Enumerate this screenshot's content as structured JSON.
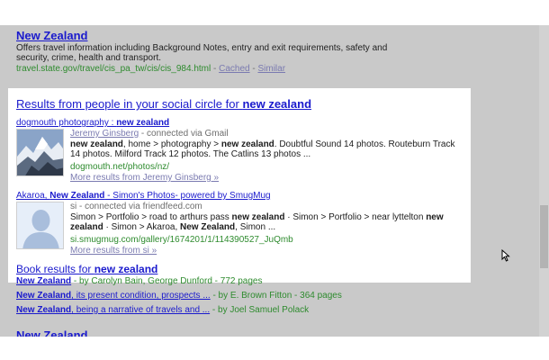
{
  "result_top": {
    "title": "New Zealand",
    "description": "Offers travel information including Background Notes, entry and exit requirements, safety and security, crime, health and transport.",
    "url": "travel.state.gov/travel/cis_pa_tw/cis/cis_984.html",
    "separator": " - ",
    "cached": "Cached",
    "similar": "Similar"
  },
  "social": {
    "heading_prefix": "Results from people in your social circle for ",
    "heading_query": "new zealand",
    "results": [
      {
        "title_prefix": "dogmouth photography : ",
        "title_bold": "new zealand",
        "author": "Jeremy Ginsberg",
        "connection": " - connected via Gmail",
        "snippet_1": "new zealand",
        "snippet_2": ", home > photography > ",
        "snippet_3": "new zealand",
        "snippet_4": ". Doubtful Sound 14 photos. Routeburn Track 14 photos. Milford Track 12 photos. The Catlins 13 photos ...",
        "url": "dogmouth.net/photos/nz/",
        "more": "More results from Jeremy Ginsberg »"
      },
      {
        "title_prefix": "Akaroa, ",
        "title_bold": "New Zealand",
        "title_suffix": " - Simon's Photos- powered by SmugMug",
        "author": "si",
        "connection": " - connected via friendfeed.com",
        "snippet_1": "Simon > Portfolio > road to arthurs pass ",
        "snippet_2": "new zealand",
        "snippet_3": " · Simon > Portfolio > near lyttelton ",
        "snippet_4": "new zealand",
        "snippet_5": " · Simon > Akaroa, ",
        "snippet_6": "New Zealand",
        "snippet_7": ", Simon ...",
        "url": "si.smugmug.com/gallery/1674201/1/114390527_JuQmb",
        "more": "More results from si »"
      }
    ]
  },
  "books": {
    "heading_prefix": "Book results for ",
    "heading_query": "new zealand",
    "items": [
      {
        "title": "New Zealand",
        "author": " - by Carolyn Bain, George Dunford - 772 pages"
      },
      {
        "title": "New Zealand",
        "title_rest": ", its present condition, prospects ...",
        "author": " - by E. Brown Fitton - 364 pages"
      },
      {
        "title": "New Zealand",
        "title_rest": ", being a narrative of travels and ...",
        "author": " - by Joel Samuel Polack"
      }
    ]
  },
  "next_result_title": "New Zealand"
}
